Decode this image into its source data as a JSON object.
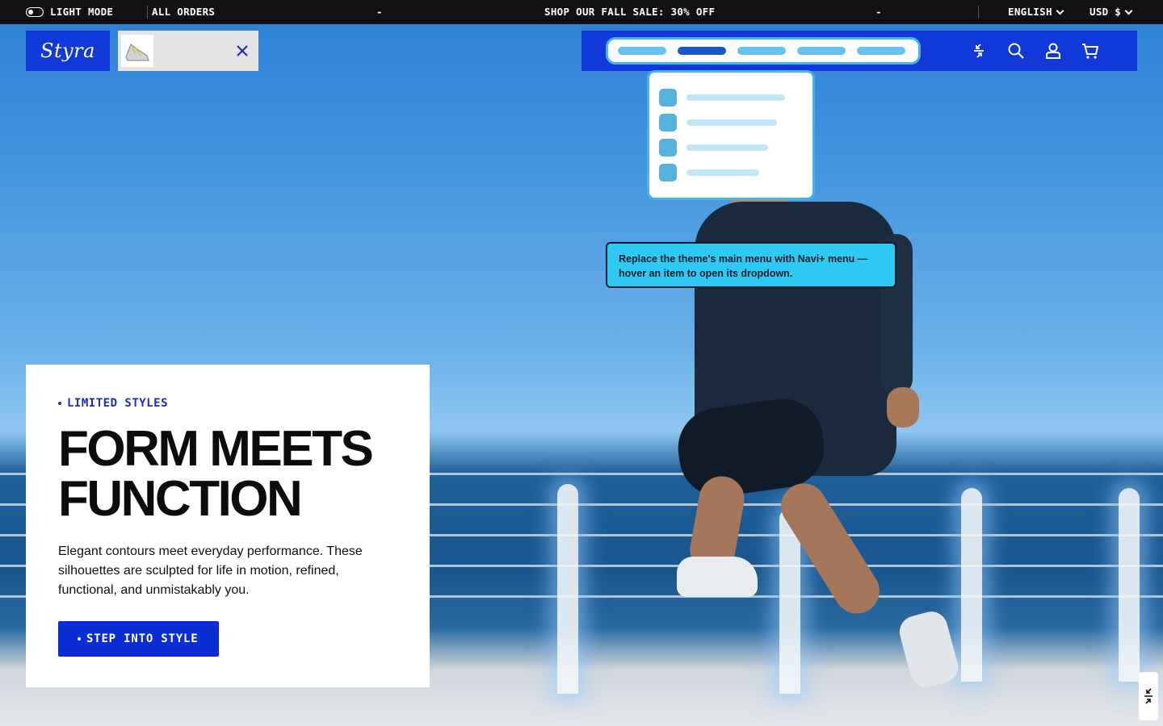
{
  "announcement": {
    "mode_label": "LIGHT MODE",
    "orders_label": "ALL ORDERS",
    "separator_left": "-",
    "sale_text": "SHOP OUR FALL SALE: 30% OFF",
    "separator_right": "-",
    "language": "ENGLISH",
    "currency": "USD $"
  },
  "header": {
    "logo_text": "Styra",
    "nav_menu_items": 5,
    "active_menu_item": 2,
    "icons": [
      "navi-plus-icon",
      "search-icon",
      "account-icon",
      "cart-icon"
    ]
  },
  "dropdown": {
    "items": 4
  },
  "tooltip": {
    "text": "Replace the theme's main menu with Navi+ menu — hover an item to open its dropdown."
  },
  "hero": {
    "eyebrow": "LIMITED STYLES",
    "headline_line1": "FORM MEETS",
    "headline_line2": "FUNCTION",
    "body": "Elegant contours meet everyday performance. These silhouettes are sculpted for life in motion, refined, functional, and unmistakably you.",
    "cta": "STEP INTO STYLE"
  },
  "colors": {
    "brand_blue": "#1138d8",
    "accent_cyan": "#2ec9f2",
    "menu_blue_light": "#67c3eb",
    "menu_blue_active": "#1a57c8"
  }
}
